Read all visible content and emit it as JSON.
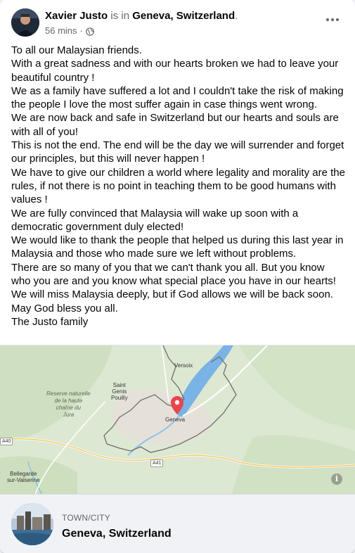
{
  "post": {
    "author": "Xavier Justo",
    "connector": "is in",
    "location": "Geneva, Switzerland",
    "period": ".",
    "time": "56 mins",
    "separator": "·",
    "privacy_icon": "globe-icon",
    "more_icon": "more-horizontal-icon",
    "text_lines": [
      "To all our Malaysian friends.",
      "With a great sadness and with our hearts broken we had to leave your beautiful country !",
      "We as a family have suffered a lot and I couldn't take the risk of making the people I love the most suffer again in case things went wrong.",
      "We are now back and safe in Switzerland but our hearts and souls are with all of you!",
      "This is not the end. The end will be the day we will surrender and forget our principles, but this will never happen !",
      "We have to give our children a world where legality and morality are the rules, if not there is no point in teaching them to be good humans with values !",
      "We are fully convinced that Malaysia will wake up soon with a democratic government duly elected!",
      "We would like to thank the people that helped us during this last year in Malaysia and those who made sure we left without problems.",
      "There are so many of you that we can't thank you all. But you know who you are and you know what special place you have in our hearts!",
      "We will miss Malaysia deeply, but if God allows we will be back soon.",
      "May God bless you all.",
      "The Justo family"
    ]
  },
  "map": {
    "labels": {
      "versoix": "Versoix",
      "saint_genis": "Saint\nGenis\nPouilly",
      "reserve": "Reserve naturelle\nde la haute\nchaîne du\nJura",
      "geneva": "Geneva",
      "bellegarde": "Bellegarde\nsur-Valserine",
      "a40": "A40",
      "a41": "A41"
    },
    "info_label": "i",
    "pin_color": "#e8454f",
    "water_color": "#7ab3e6",
    "land_color": "#dfe9d6"
  },
  "place": {
    "kicker": "TOWN/CITY",
    "name": "Geneva, Switzerland"
  }
}
